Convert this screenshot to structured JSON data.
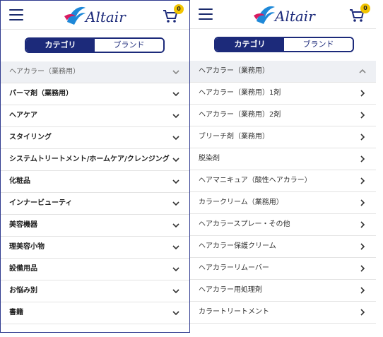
{
  "header": {
    "logo_text": "Altair",
    "cart_count": "0"
  },
  "tabs": {
    "category": "カテゴリ",
    "brand": "ブランド"
  },
  "left_panel": {
    "section_header": "ヘアカラー（業務用）",
    "categories": [
      "パーマ剤（業務用）",
      "ヘアケア",
      "スタイリング",
      "システムトリートメント/ホームケア/クレンジング",
      "化粧品",
      "インナービューティ",
      "美容機器",
      "理美容小物",
      "設備用品",
      "お悩み別",
      "書籍"
    ]
  },
  "right_panel": {
    "section_header": "ヘアカラー（業務用）",
    "subcategories": [
      "ヘアカラー（業務用）1剤",
      "ヘアカラー（業務用）2剤",
      "ブリーチ剤（業務用）",
      "脱染剤",
      "ヘアマニキュア（酸性ヘアカラー）",
      "カラークリーム（業務用）",
      "ヘアカラースプレー・その他",
      "ヘアカラー保護クリーム",
      "ヘアカラーリムーバー",
      "ヘアカラー用処理剤",
      "カラートリートメント"
    ]
  },
  "colors": {
    "brand_navy": "#1c2a7a",
    "badge_yellow": "#f2c400",
    "header_row_bg": "#eef0f4"
  },
  "icons": [
    "hamburger-icon",
    "cart-icon",
    "chevron-down-icon",
    "chevron-up-icon",
    "chevron-right-icon"
  ]
}
